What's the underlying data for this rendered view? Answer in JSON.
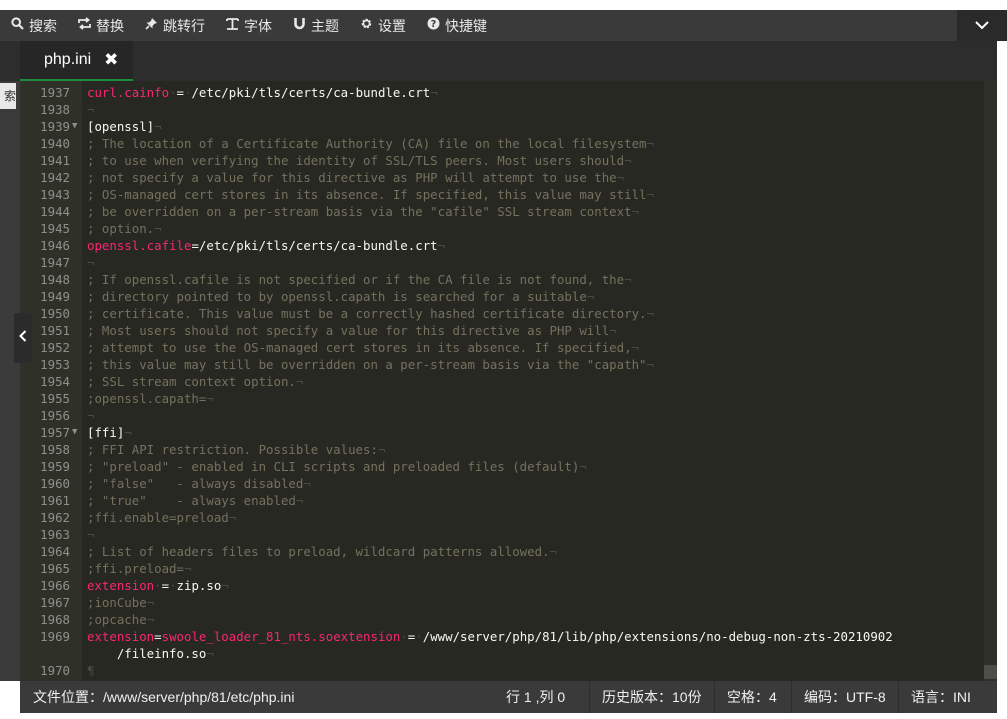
{
  "toolbar": {
    "items": [
      {
        "icon": "search-icon",
        "glyph": "🔍",
        "label": "搜索"
      },
      {
        "icon": "replace-icon",
        "glyph": "⇆",
        "label": "替换"
      },
      {
        "icon": "pin-icon",
        "glyph": "✎",
        "label": "跳转行"
      },
      {
        "icon": "font-icon",
        "glyph": "T",
        "label": "字体"
      },
      {
        "icon": "theme-icon",
        "glyph": "U",
        "label": "主题"
      },
      {
        "icon": "gear-icon",
        "glyph": "⚙",
        "label": "设置"
      },
      {
        "icon": "help-icon",
        "glyph": "?",
        "label": "快捷键"
      }
    ]
  },
  "tab": {
    "label": "php.ini",
    "close": "✖"
  },
  "sidebar": {
    "search_fragment": "索"
  },
  "editor": {
    "lines": [
      {
        "n": "1937",
        "fold": false,
        "parts": [
          [
            "k",
            "curl.cainfo"
          ],
          [
            "inv",
            "·"
          ],
          [
            "v",
            "="
          ],
          [
            "inv",
            "·"
          ],
          [
            "v",
            "/etc/pki/tls/certs/ca-bundle.crt"
          ],
          [
            "inv",
            "¬"
          ]
        ]
      },
      {
        "n": "1938",
        "fold": false,
        "parts": [
          [
            "inv",
            "¬"
          ]
        ]
      },
      {
        "n": "1939",
        "fold": true,
        "parts": [
          [
            "v",
            "[openssl]"
          ],
          [
            "inv",
            "¬"
          ]
        ]
      },
      {
        "n": "1940",
        "fold": false,
        "parts": [
          [
            "c",
            "; The location of a Certificate Authority (CA) file on the local filesystem"
          ],
          [
            "inv",
            "¬"
          ]
        ]
      },
      {
        "n": "1941",
        "fold": false,
        "parts": [
          [
            "c",
            "; to use when verifying the identity of SSL/TLS peers. Most users should"
          ],
          [
            "inv",
            "¬"
          ]
        ]
      },
      {
        "n": "1942",
        "fold": false,
        "parts": [
          [
            "c",
            "; not specify a value for this directive as PHP will attempt to use the"
          ],
          [
            "inv",
            "¬"
          ]
        ]
      },
      {
        "n": "1943",
        "fold": false,
        "parts": [
          [
            "c",
            "; OS-managed cert stores in its absence. If specified, this value may still"
          ],
          [
            "inv",
            "¬"
          ]
        ]
      },
      {
        "n": "1944",
        "fold": false,
        "parts": [
          [
            "c",
            "; be overridden on a per-stream basis via the \"cafile\" SSL stream context"
          ],
          [
            "inv",
            "¬"
          ]
        ]
      },
      {
        "n": "1945",
        "fold": false,
        "parts": [
          [
            "c",
            "; option."
          ],
          [
            "inv",
            "¬"
          ]
        ]
      },
      {
        "n": "1946",
        "fold": false,
        "parts": [
          [
            "k",
            "openssl.cafile"
          ],
          [
            "v",
            "=/etc/pki/tls/certs/ca-bundle.crt"
          ],
          [
            "inv",
            "¬"
          ]
        ]
      },
      {
        "n": "1947",
        "fold": false,
        "parts": [
          [
            "inv",
            "¬"
          ]
        ]
      },
      {
        "n": "1948",
        "fold": false,
        "parts": [
          [
            "c",
            "; If openssl.cafile is not specified or if the CA file is not found, the"
          ],
          [
            "inv",
            "¬"
          ]
        ]
      },
      {
        "n": "1949",
        "fold": false,
        "parts": [
          [
            "c",
            "; directory pointed to by openssl.capath is searched for a suitable"
          ],
          [
            "inv",
            "¬"
          ]
        ]
      },
      {
        "n": "1950",
        "fold": false,
        "parts": [
          [
            "c",
            "; certificate. This value must be a correctly hashed certificate directory."
          ],
          [
            "inv",
            "¬"
          ]
        ]
      },
      {
        "n": "1951",
        "fold": false,
        "parts": [
          [
            "c",
            "; Most users should not specify a value for this directive as PHP will"
          ],
          [
            "inv",
            "¬"
          ]
        ]
      },
      {
        "n": "1952",
        "fold": false,
        "parts": [
          [
            "c",
            "; attempt to use the OS-managed cert stores in its absence. If specified,"
          ],
          [
            "inv",
            "¬"
          ]
        ]
      },
      {
        "n": "1953",
        "fold": false,
        "parts": [
          [
            "c",
            "; this value may still be overridden on a per-stream basis via the \"capath\""
          ],
          [
            "inv",
            "¬"
          ]
        ]
      },
      {
        "n": "1954",
        "fold": false,
        "parts": [
          [
            "c",
            "; SSL stream context option."
          ],
          [
            "inv",
            "¬"
          ]
        ]
      },
      {
        "n": "1955",
        "fold": false,
        "parts": [
          [
            "c",
            ";openssl.capath="
          ],
          [
            "inv",
            "¬"
          ]
        ]
      },
      {
        "n": "1956",
        "fold": false,
        "parts": [
          [
            "inv",
            "¬"
          ]
        ]
      },
      {
        "n": "1957",
        "fold": true,
        "parts": [
          [
            "v",
            "[ffi]"
          ],
          [
            "inv",
            "¬"
          ]
        ]
      },
      {
        "n": "1958",
        "fold": false,
        "parts": [
          [
            "c",
            "; FFI API restriction. Possible values:"
          ],
          [
            "inv",
            "¬"
          ]
        ]
      },
      {
        "n": "1959",
        "fold": false,
        "parts": [
          [
            "c",
            "; \"preload\" - enabled in CLI scripts and preloaded files (default)"
          ],
          [
            "inv",
            "¬"
          ]
        ]
      },
      {
        "n": "1960",
        "fold": false,
        "parts": [
          [
            "c",
            "; \"false\"   - always disabled"
          ],
          [
            "inv",
            "¬"
          ]
        ]
      },
      {
        "n": "1961",
        "fold": false,
        "parts": [
          [
            "c",
            "; \"true\"    - always enabled"
          ],
          [
            "inv",
            "¬"
          ]
        ]
      },
      {
        "n": "1962",
        "fold": false,
        "parts": [
          [
            "c",
            ";ffi.enable=preload"
          ],
          [
            "inv",
            "¬"
          ]
        ]
      },
      {
        "n": "1963",
        "fold": false,
        "parts": [
          [
            "inv",
            "¬"
          ]
        ]
      },
      {
        "n": "1964",
        "fold": false,
        "parts": [
          [
            "c",
            "; List of headers files to preload, wildcard patterns allowed."
          ],
          [
            "inv",
            "¬"
          ]
        ]
      },
      {
        "n": "1965",
        "fold": false,
        "parts": [
          [
            "c",
            ";ffi.preload="
          ],
          [
            "inv",
            "¬"
          ]
        ]
      },
      {
        "n": "1966",
        "fold": false,
        "parts": [
          [
            "k",
            "extension"
          ],
          [
            "inv",
            "·"
          ],
          [
            "v",
            "="
          ],
          [
            "inv",
            "·"
          ],
          [
            "v",
            "zip.so"
          ],
          [
            "inv",
            "¬"
          ]
        ]
      },
      {
        "n": "1967",
        "fold": false,
        "parts": [
          [
            "c",
            ";ionCube"
          ],
          [
            "inv",
            "¬"
          ]
        ]
      },
      {
        "n": "1968",
        "fold": false,
        "parts": [
          [
            "c",
            ";opcache"
          ],
          [
            "inv",
            "¬"
          ]
        ]
      },
      {
        "n": "1969",
        "fold": false,
        "parts": [
          [
            "k",
            "extension"
          ],
          [
            "v",
            "="
          ],
          [
            "k",
            "swoole_loader_81_nts.so"
          ],
          [
            "k",
            "extension"
          ],
          [
            "inv",
            "·"
          ],
          [
            "v",
            "="
          ],
          [
            "inv",
            "·"
          ],
          [
            "v",
            "/www/server/php/81/lib/php/extensions/no-debug-non-zts-20210902"
          ]
        ]
      },
      {
        "n": "",
        "fold": false,
        "parts": [
          [
            "v",
            "    /fileinfo.so"
          ],
          [
            "inv",
            "¬"
          ]
        ]
      },
      {
        "n": "1970",
        "fold": false,
        "parts": [
          [
            "inv",
            "¶"
          ]
        ]
      }
    ]
  },
  "status": {
    "file_location": "文件位置：/www/server/php/81/etc/php.ini",
    "cursor": "行 1 ,列 0",
    "history": "历史版本：10份",
    "indent": "空格：4",
    "encoding": "编码：UTF-8",
    "language": "语言：INI"
  }
}
